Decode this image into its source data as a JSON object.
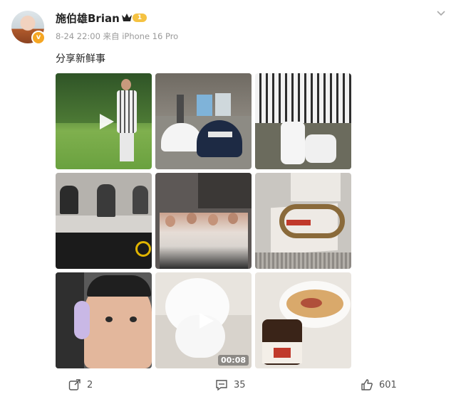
{
  "user": {
    "name": "施伯雄Brian",
    "level": "1"
  },
  "post": {
    "meta": "8-24 22:00  来自 iPhone 16 Pro",
    "text": "分享新鲜事",
    "video_duration": "00:08"
  },
  "actions": {
    "repost_count": "2",
    "comment_count": "35",
    "like_count": "601"
  },
  "icons": {
    "more": "chevron-down-icon",
    "repost": "repost-icon",
    "comment": "comment-icon",
    "like": "thumbs-up-icon",
    "play": "play-icon"
  }
}
